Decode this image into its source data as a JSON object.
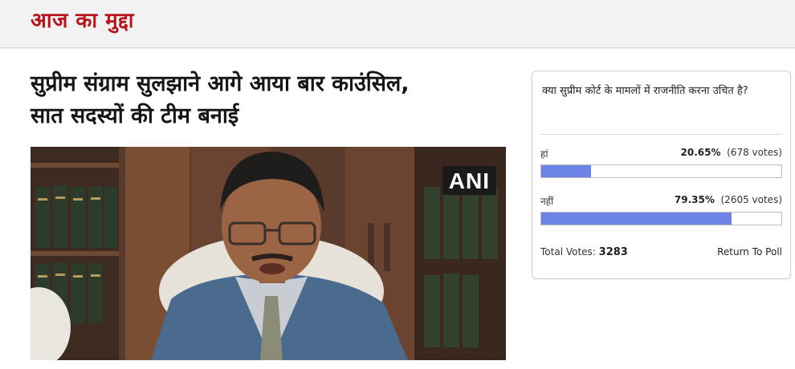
{
  "section": {
    "title": "आज का मुद्दा"
  },
  "article": {
    "headline_line1": "सुप्रीम संग्राम सुलझाने आगे आया बार काउंसिल,",
    "headline_line2": "सात सदस्यों की टीम बनाई",
    "image_watermark": "ANI"
  },
  "poll": {
    "question": "क्या सुप्रीम कोर्ट के मामलों में राजनीति करना उचित है?",
    "options": [
      {
        "label": "हां",
        "percent_text": "20.65%",
        "votes_text": "(678 votes)",
        "fraction": 0.2065
      },
      {
        "label": "नहीं",
        "percent_text": "79.35%",
        "votes_text": "(2605 votes)",
        "fraction": 0.7935
      }
    ],
    "total_label": "Total Votes:",
    "total_value": "3283",
    "return_label": "Return To Poll",
    "bar_color": "#6b84e6"
  },
  "colors": {
    "section_title": "#b8141c"
  }
}
